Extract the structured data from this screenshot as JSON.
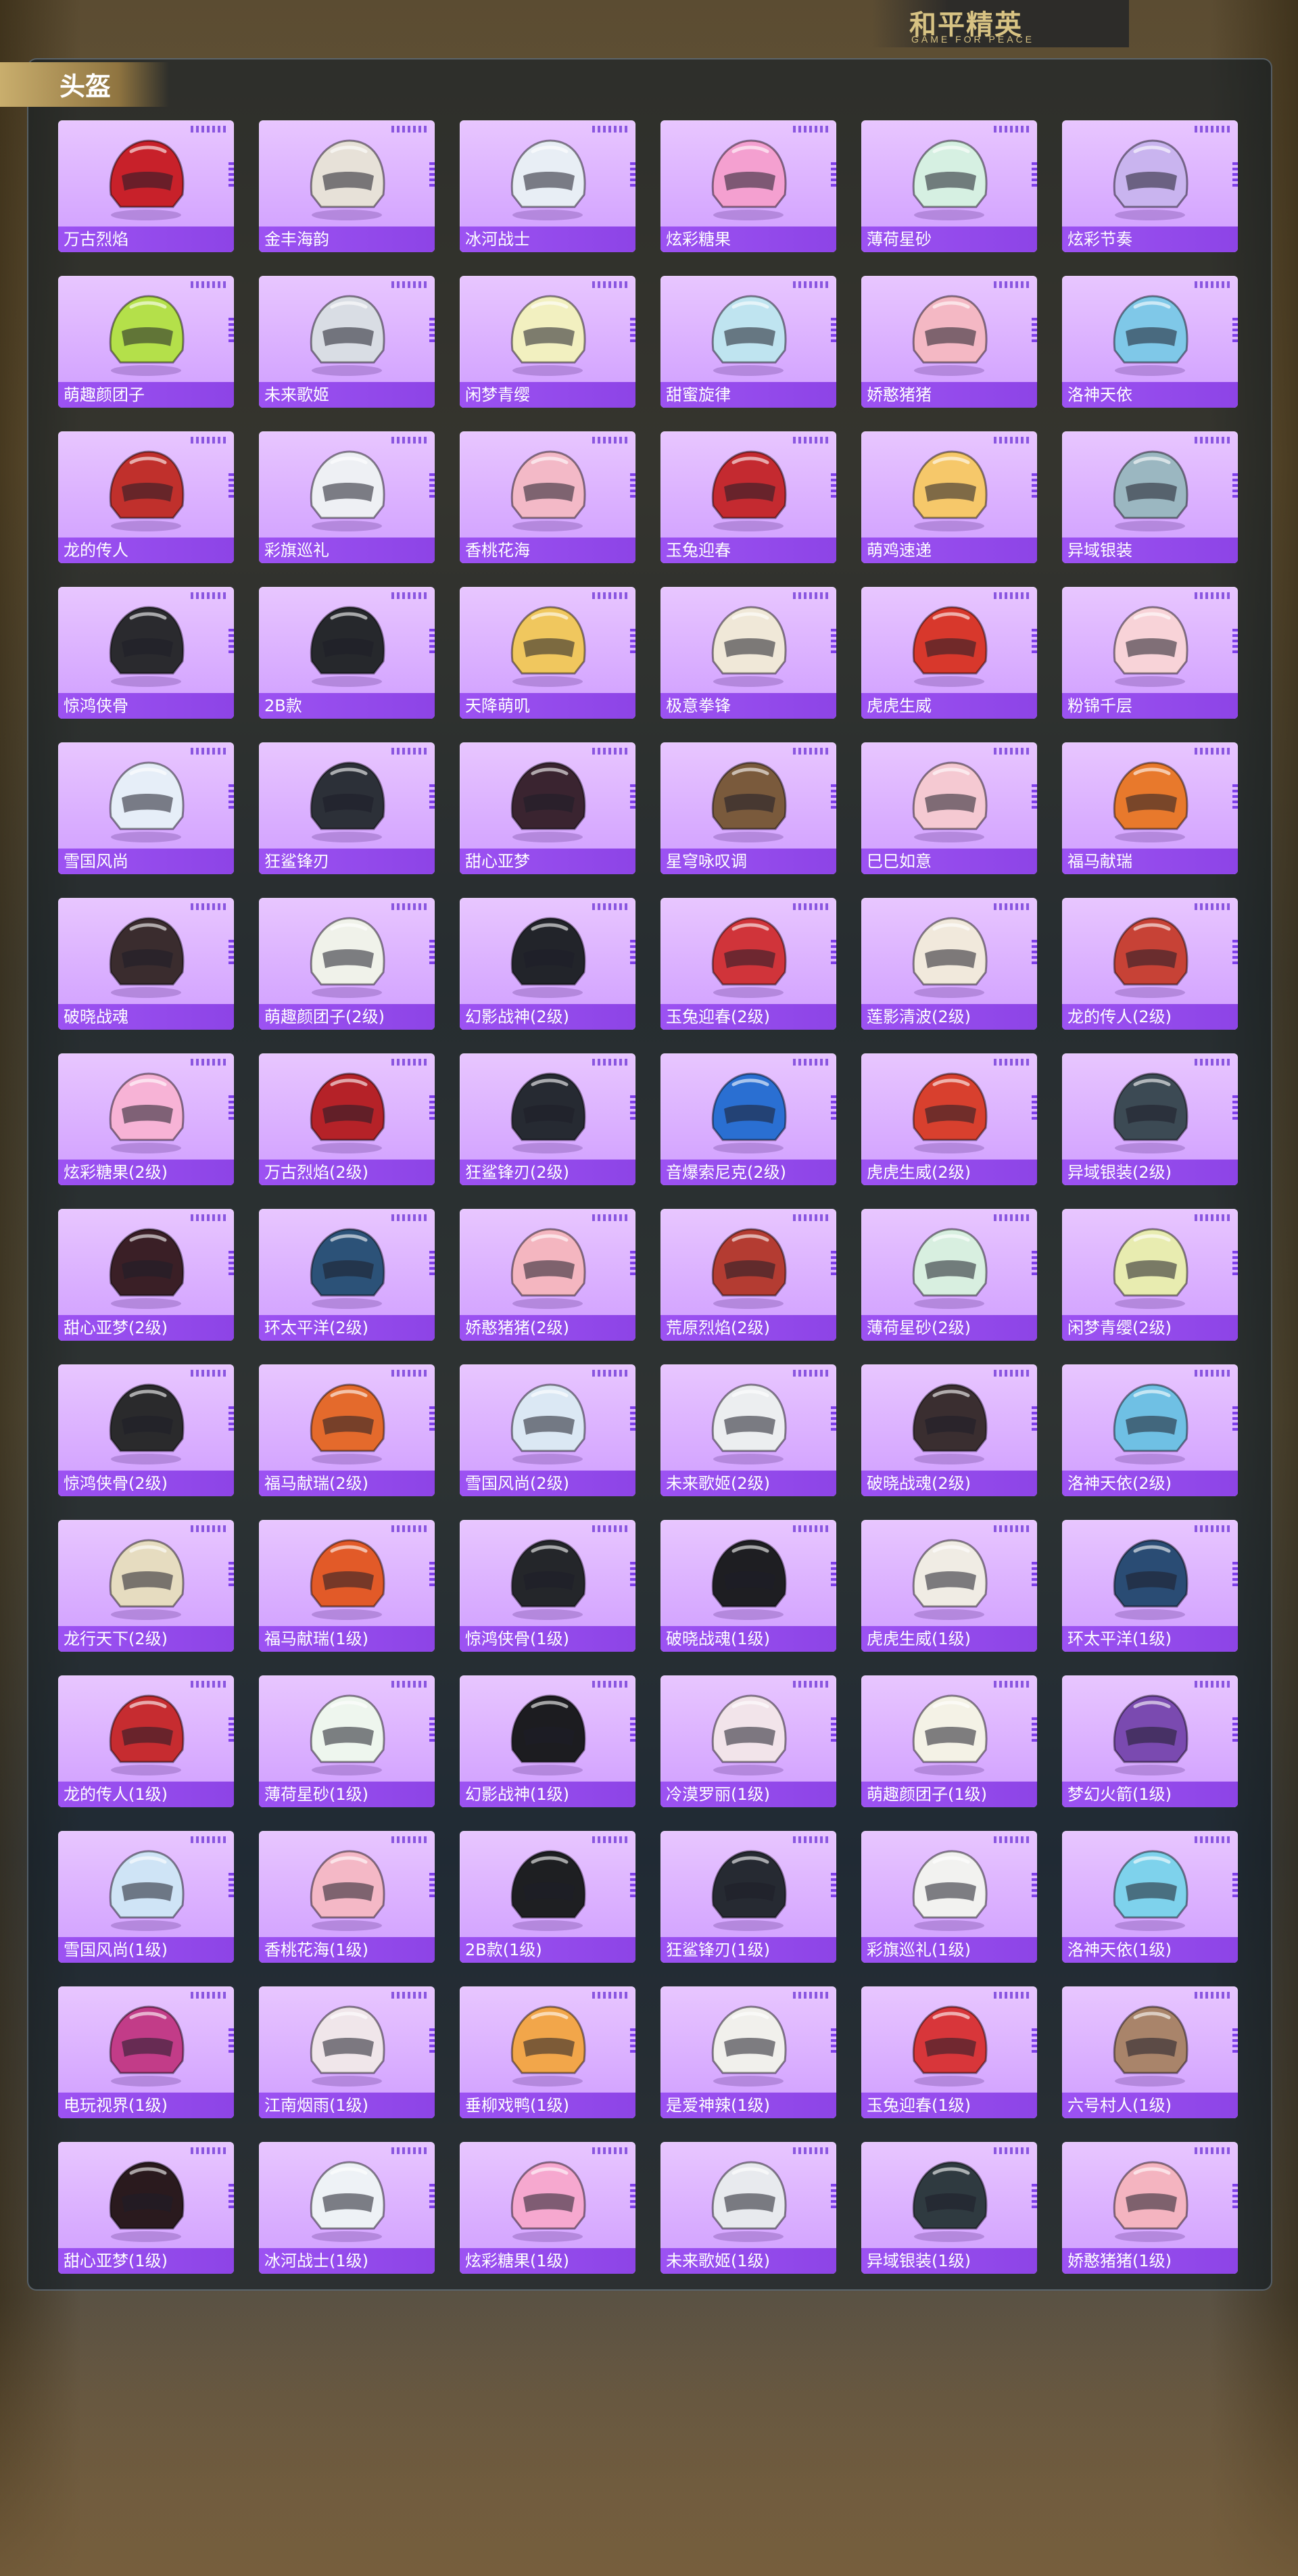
{
  "brand": {
    "title": "和平精英",
    "subtitle": "GAME FOR PEACE"
  },
  "section": {
    "title": "头盔"
  },
  "colors": {
    "card_bg_top": "#e8c6ff",
    "card_bg_bottom": "#cf9dff",
    "label_bg": "#9c52f2",
    "accent_gold": "#d8c383"
  },
  "items": [
    {
      "name": "万古烈焰",
      "color": "#c8212a",
      "icon": "helmet-icon"
    },
    {
      "name": "金丰海韵",
      "color": "#e7e1d8",
      "icon": "helmet-icon"
    },
    {
      "name": "冰河战士",
      "color": "#e8eef5",
      "icon": "helmet-icon"
    },
    {
      "name": "炫彩糖果",
      "color": "#f4a0d0",
      "icon": "helmet-icon"
    },
    {
      "name": "薄荷星砂",
      "color": "#d6f0e2",
      "icon": "helmet-icon"
    },
    {
      "name": "炫彩节奏",
      "color": "#c9b4ef",
      "icon": "helmet-icon"
    },
    {
      "name": "萌趣颜团子",
      "color": "#b4e04a",
      "icon": "helmet-icon"
    },
    {
      "name": "未来歌姬",
      "color": "#d9dde4",
      "icon": "helmet-icon"
    },
    {
      "name": "闲梦青缨",
      "color": "#f2f0c0",
      "icon": "helmet-icon"
    },
    {
      "name": "甜蜜旋律",
      "color": "#bfe4f0",
      "icon": "helmet-icon"
    },
    {
      "name": "娇憨猪猪",
      "color": "#f4b8c4",
      "icon": "helmet-icon"
    },
    {
      "name": "洛神天依",
      "color": "#7fc8e8",
      "icon": "helmet-icon"
    },
    {
      "name": "龙的传人",
      "color": "#c0302c",
      "icon": "helmet-icon"
    },
    {
      "name": "彩旗巡礼",
      "color": "#eef0f4",
      "icon": "helmet-icon"
    },
    {
      "name": "香桃花海",
      "color": "#f3b9c7",
      "icon": "helmet-icon"
    },
    {
      "name": "玉兔迎春",
      "color": "#c42a30",
      "icon": "helmet-icon"
    },
    {
      "name": "萌鸡速递",
      "color": "#f6c86a",
      "icon": "helmet-icon"
    },
    {
      "name": "异域银装",
      "color": "#9bb7c1",
      "icon": "helmet-icon"
    },
    {
      "name": "惊鸿侠骨",
      "color": "#2a2a2e",
      "icon": "helmet-icon"
    },
    {
      "name": "2B款",
      "color": "#26282c",
      "icon": "helmet-icon"
    },
    {
      "name": "天降萌叽",
      "color": "#f0c75e",
      "icon": "helmet-icon"
    },
    {
      "name": "极意拳锋",
      "color": "#f0e8d8",
      "icon": "helmet-icon"
    },
    {
      "name": "虎虎生威",
      "color": "#d8382c",
      "icon": "helmet-icon"
    },
    {
      "name": "粉锦千层",
      "color": "#f8d3d8",
      "icon": "helmet-icon"
    },
    {
      "name": "雪国风尚",
      "color": "#e6eef8",
      "icon": "helmet-icon"
    },
    {
      "name": "狂鲨锋刃",
      "color": "#2c3038",
      "icon": "helmet-icon"
    },
    {
      "name": "甜心亚梦",
      "color": "#3a2430",
      "icon": "helmet-icon"
    },
    {
      "name": "星穹咏叹调",
      "color": "#7a5a3c",
      "icon": "helmet-icon"
    },
    {
      "name": "巳巳如意",
      "color": "#f5c9d2",
      "icon": "helmet-icon"
    },
    {
      "name": "福马献瑞",
      "color": "#e8792c",
      "icon": "helmet-icon"
    },
    {
      "name": "破晓战魂",
      "color": "#3a2c2e",
      "icon": "helmet-icon"
    },
    {
      "name": "萌趣颜团子(2级)",
      "color": "#f0f2ea",
      "icon": "helmet-icon"
    },
    {
      "name": "幻影战神(2级)",
      "color": "#22242a",
      "icon": "helmet-icon"
    },
    {
      "name": "玉兔迎春(2级)",
      "color": "#d0343a",
      "icon": "helmet-icon"
    },
    {
      "name": "莲影清波(2级)",
      "color": "#f1e9dc",
      "icon": "helmet-icon"
    },
    {
      "name": "龙的传人(2级)",
      "color": "#c74236",
      "icon": "helmet-icon"
    },
    {
      "name": "炫彩糖果(2级)",
      "color": "#f7b3d6",
      "icon": "helmet-icon"
    },
    {
      "name": "万古烈焰(2级)",
      "color": "#b52228",
      "icon": "helmet-icon"
    },
    {
      "name": "狂鲨锋刃(2级)",
      "color": "#262a32",
      "icon": "helmet-icon"
    },
    {
      "name": "音爆索尼克(2级)",
      "color": "#2a6fd2",
      "icon": "helmet-icon"
    },
    {
      "name": "虎虎生威(2级)",
      "color": "#d8402e",
      "icon": "helmet-icon"
    },
    {
      "name": "异域银装(2级)",
      "color": "#3c4a54",
      "icon": "helmet-icon"
    },
    {
      "name": "甜心亚梦(2级)",
      "color": "#3a1f26",
      "icon": "helmet-icon"
    },
    {
      "name": "环太平洋(2级)",
      "color": "#2c5278",
      "icon": "helmet-icon"
    },
    {
      "name": "娇憨猪猪(2级)",
      "color": "#f4b6c0",
      "icon": "helmet-icon"
    },
    {
      "name": "荒原烈焰(2级)",
      "color": "#b43c32",
      "icon": "helmet-icon"
    },
    {
      "name": "薄荷星砂(2级)",
      "color": "#d8efe0",
      "icon": "helmet-icon"
    },
    {
      "name": "闲梦青缨(2级)",
      "color": "#e8ecb0",
      "icon": "helmet-icon"
    },
    {
      "name": "惊鸿侠骨(2级)",
      "color": "#2a2a2c",
      "icon": "helmet-icon"
    },
    {
      "name": "福马献瑞(2级)",
      "color": "#e46a2c",
      "icon": "helmet-icon"
    },
    {
      "name": "雪国风尚(2级)",
      "color": "#dbe8f4",
      "icon": "helmet-icon"
    },
    {
      "name": "未来歌姬(2级)",
      "color": "#eceef0",
      "icon": "helmet-icon"
    },
    {
      "name": "破晓战魂(2级)",
      "color": "#3a2e30",
      "icon": "helmet-icon"
    },
    {
      "name": "洛神天依(2级)",
      "color": "#6fc0e4",
      "icon": "helmet-icon"
    },
    {
      "name": "龙行天下(2级)",
      "color": "#e6dcc0",
      "icon": "helmet-icon"
    },
    {
      "name": "福马献瑞(1级)",
      "color": "#e25a28",
      "icon": "helmet-icon"
    },
    {
      "name": "惊鸿侠骨(1级)",
      "color": "#24262a",
      "icon": "helmet-icon"
    },
    {
      "name": "破晓战魂(1级)",
      "color": "#1e1e22",
      "icon": "helmet-icon"
    },
    {
      "name": "虎虎生威(1级)",
      "color": "#f0ece4",
      "icon": "helmet-icon"
    },
    {
      "name": "环太平洋(1级)",
      "color": "#2a4c74",
      "icon": "helmet-icon"
    },
    {
      "name": "龙的传人(1级)",
      "color": "#c62c30",
      "icon": "helmet-icon"
    },
    {
      "name": "薄荷星砂(1级)",
      "color": "#eef6ee",
      "icon": "helmet-icon"
    },
    {
      "name": "幻影战神(1级)",
      "color": "#1c1c20",
      "icon": "helmet-icon"
    },
    {
      "name": "冷漠罗丽(1级)",
      "color": "#f2e4ea",
      "icon": "helmet-icon"
    },
    {
      "name": "萌趣颜团子(1级)",
      "color": "#f4f2e6",
      "icon": "helmet-icon"
    },
    {
      "name": "梦幻火箭(1级)",
      "color": "#7a4ab0",
      "icon": "helmet-icon"
    },
    {
      "name": "雪国风尚(1级)",
      "color": "#cfe4f6",
      "icon": "helmet-icon"
    },
    {
      "name": "香桃花海(1级)",
      "color": "#f4b8c6",
      "icon": "helmet-icon"
    },
    {
      "name": "2B款(1级)",
      "color": "#1e1f22",
      "icon": "helmet-icon"
    },
    {
      "name": "狂鲨锋刃(1级)",
      "color": "#262a32",
      "icon": "helmet-icon"
    },
    {
      "name": "彩旗巡礼(1级)",
      "color": "#f2f2f0",
      "icon": "helmet-icon"
    },
    {
      "name": "洛神天依(1级)",
      "color": "#7ed2ec",
      "icon": "helmet-icon"
    },
    {
      "name": "电玩视界(1级)",
      "color": "#c23c88",
      "icon": "helmet-icon"
    },
    {
      "name": "江南烟雨(1级)",
      "color": "#f0e6ea",
      "icon": "helmet-icon"
    },
    {
      "name": "垂柳戏鸭(1级)",
      "color": "#f2a64a",
      "icon": "helmet-icon"
    },
    {
      "name": "是爱神辣(1级)",
      "color": "#f1f0ec",
      "icon": "helmet-icon"
    },
    {
      "name": "玉兔迎春(1级)",
      "color": "#d8363a",
      "icon": "helmet-icon"
    },
    {
      "name": "六号村人(1级)",
      "color": "#a9846a",
      "icon": "helmet-icon"
    },
    {
      "name": "甜心亚梦(1级)",
      "color": "#2a1a1e",
      "icon": "helmet-icon"
    },
    {
      "name": "冰河战士(1级)",
      "color": "#eef2f6",
      "icon": "helmet-icon"
    },
    {
      "name": "炫彩糖果(1级)",
      "color": "#f6a8cf",
      "icon": "helmet-icon"
    },
    {
      "name": "未来歌姬(1级)",
      "color": "#e8eaee",
      "icon": "helmet-icon"
    },
    {
      "name": "异域银装(1级)",
      "color": "#2f3a40",
      "icon": "helmet-icon"
    },
    {
      "name": "娇憨猪猪(1级)",
      "color": "#f4b4c0",
      "icon": "helmet-icon"
    }
  ]
}
